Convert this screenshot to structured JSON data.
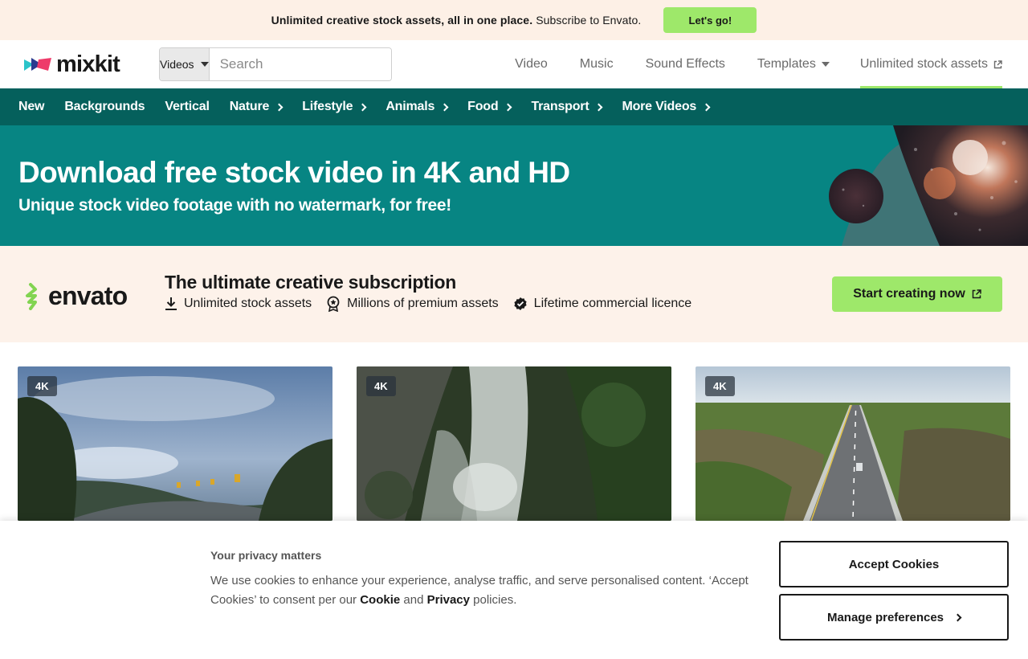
{
  "promo": {
    "bold_text": "Unlimited creative stock assets, all in one place.",
    "text": "Subscribe to Envato.",
    "button": "Let's go!"
  },
  "header": {
    "logo": "mixkit",
    "search": {
      "type": "Videos",
      "placeholder": "Search"
    },
    "nav": [
      {
        "label": "Video"
      },
      {
        "label": "Music"
      },
      {
        "label": "Sound Effects"
      },
      {
        "label": "Templates"
      },
      {
        "label": "Unlimited stock assets"
      }
    ]
  },
  "categories": [
    {
      "label": "New"
    },
    {
      "label": "Backgrounds"
    },
    {
      "label": "Vertical"
    },
    {
      "label": "Nature"
    },
    {
      "label": "Lifestyle"
    },
    {
      "label": "Animals"
    },
    {
      "label": "Food"
    },
    {
      "label": "Transport"
    },
    {
      "label": "More Videos"
    }
  ],
  "hero": {
    "title": "Download free stock video in 4K and HD",
    "subtitle": "Unique stock video footage with no watermark, for free!"
  },
  "envato": {
    "logo": "envato",
    "title": "The ultimate creative subscription",
    "features": [
      "Unlimited stock assets",
      "Millions of premium assets",
      "Lifetime commercial licence"
    ],
    "button": "Start creating now"
  },
  "videos": [
    {
      "badge": "4K"
    },
    {
      "badge": "4K"
    },
    {
      "badge": "4K"
    }
  ],
  "cookie": {
    "title": "Your privacy matters",
    "body_1": "We use cookies to enhance your experience, analyse traffic, and serve personalised content. ‘Accept Cookies’ to consent per our ",
    "cookie_link": "Cookie",
    "and": " and ",
    "privacy_link": "Privacy",
    "body_2": " policies.",
    "accept": "Accept Cookies",
    "manage": "Manage preferences"
  },
  "colors": {
    "accent_green": "#9ee86a",
    "dark_teal": "#05605c",
    "teal": "#078583",
    "cream": "#fdf0e6"
  }
}
